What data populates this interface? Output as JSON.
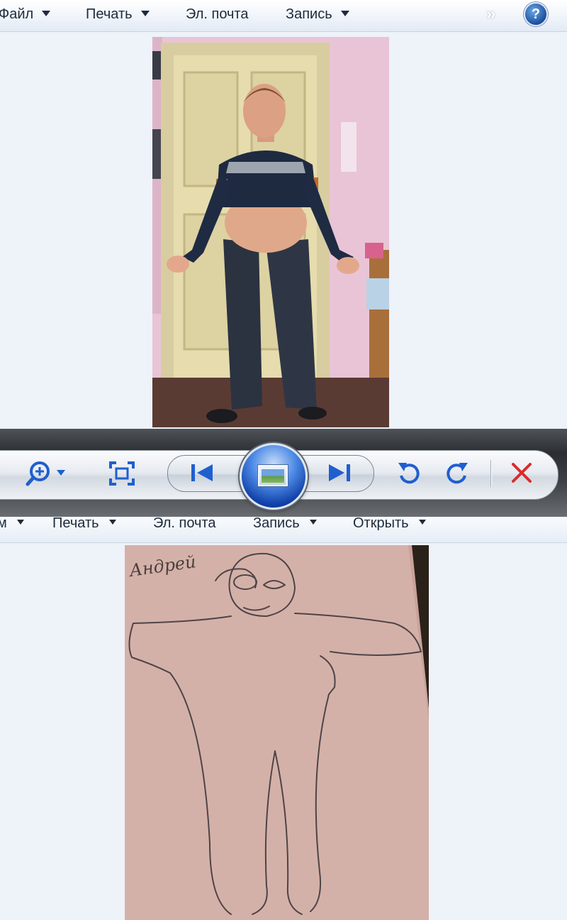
{
  "top_window": {
    "menu": [
      {
        "label": "Файл",
        "has_dropdown": true
      },
      {
        "label": "Печать",
        "has_dropdown": true
      },
      {
        "label": "Эл. почта",
        "has_dropdown": false
      },
      {
        "label": "Запись",
        "has_dropdown": true
      }
    ],
    "overflow_glyph": "»",
    "help_glyph": "?"
  },
  "controls": {
    "zoom_icon": "zoom-in-icon",
    "fit_icon": "actual-size-icon",
    "previous_icon": "previous-icon",
    "slideshow_icon": "slideshow-icon",
    "next_icon": "next-icon",
    "rotate_ccw_icon": "rotate-counterclockwise-icon",
    "rotate_cw_icon": "rotate-clockwise-icon",
    "delete_icon": "delete-icon",
    "accent_blue": "#1f5fcf",
    "delete_red": "#d92c2c"
  },
  "bottom_window": {
    "menu": [
      {
        "label": "м",
        "has_dropdown": true
      },
      {
        "label": "Печать",
        "has_dropdown": true
      },
      {
        "label": "Эл. почта",
        "has_dropdown": false
      },
      {
        "label": "Запись",
        "has_dropdown": true
      },
      {
        "label": "Открыть",
        "has_dropdown": true
      }
    ],
    "drawing_caption": "Андрей"
  }
}
